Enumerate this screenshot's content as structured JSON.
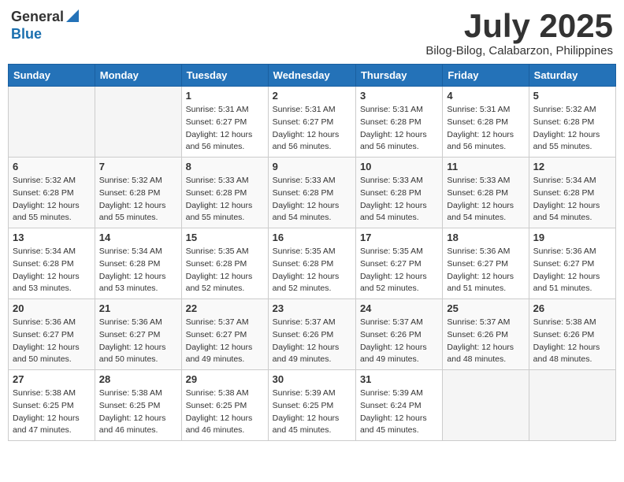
{
  "header": {
    "logo_general": "General",
    "logo_blue": "Blue",
    "month": "July 2025",
    "location": "Bilog-Bilog, Calabarzon, Philippines"
  },
  "weekdays": [
    "Sunday",
    "Monday",
    "Tuesday",
    "Wednesday",
    "Thursday",
    "Friday",
    "Saturday"
  ],
  "weeks": [
    [
      {
        "day": "",
        "info": ""
      },
      {
        "day": "",
        "info": ""
      },
      {
        "day": "1",
        "info": "Sunrise: 5:31 AM\nSunset: 6:27 PM\nDaylight: 12 hours and 56 minutes."
      },
      {
        "day": "2",
        "info": "Sunrise: 5:31 AM\nSunset: 6:27 PM\nDaylight: 12 hours and 56 minutes."
      },
      {
        "day": "3",
        "info": "Sunrise: 5:31 AM\nSunset: 6:28 PM\nDaylight: 12 hours and 56 minutes."
      },
      {
        "day": "4",
        "info": "Sunrise: 5:31 AM\nSunset: 6:28 PM\nDaylight: 12 hours and 56 minutes."
      },
      {
        "day": "5",
        "info": "Sunrise: 5:32 AM\nSunset: 6:28 PM\nDaylight: 12 hours and 55 minutes."
      }
    ],
    [
      {
        "day": "6",
        "info": "Sunrise: 5:32 AM\nSunset: 6:28 PM\nDaylight: 12 hours and 55 minutes."
      },
      {
        "day": "7",
        "info": "Sunrise: 5:32 AM\nSunset: 6:28 PM\nDaylight: 12 hours and 55 minutes."
      },
      {
        "day": "8",
        "info": "Sunrise: 5:33 AM\nSunset: 6:28 PM\nDaylight: 12 hours and 55 minutes."
      },
      {
        "day": "9",
        "info": "Sunrise: 5:33 AM\nSunset: 6:28 PM\nDaylight: 12 hours and 54 minutes."
      },
      {
        "day": "10",
        "info": "Sunrise: 5:33 AM\nSunset: 6:28 PM\nDaylight: 12 hours and 54 minutes."
      },
      {
        "day": "11",
        "info": "Sunrise: 5:33 AM\nSunset: 6:28 PM\nDaylight: 12 hours and 54 minutes."
      },
      {
        "day": "12",
        "info": "Sunrise: 5:34 AM\nSunset: 6:28 PM\nDaylight: 12 hours and 54 minutes."
      }
    ],
    [
      {
        "day": "13",
        "info": "Sunrise: 5:34 AM\nSunset: 6:28 PM\nDaylight: 12 hours and 53 minutes."
      },
      {
        "day": "14",
        "info": "Sunrise: 5:34 AM\nSunset: 6:28 PM\nDaylight: 12 hours and 53 minutes."
      },
      {
        "day": "15",
        "info": "Sunrise: 5:35 AM\nSunset: 6:28 PM\nDaylight: 12 hours and 52 minutes."
      },
      {
        "day": "16",
        "info": "Sunrise: 5:35 AM\nSunset: 6:28 PM\nDaylight: 12 hours and 52 minutes."
      },
      {
        "day": "17",
        "info": "Sunrise: 5:35 AM\nSunset: 6:27 PM\nDaylight: 12 hours and 52 minutes."
      },
      {
        "day": "18",
        "info": "Sunrise: 5:36 AM\nSunset: 6:27 PM\nDaylight: 12 hours and 51 minutes."
      },
      {
        "day": "19",
        "info": "Sunrise: 5:36 AM\nSunset: 6:27 PM\nDaylight: 12 hours and 51 minutes."
      }
    ],
    [
      {
        "day": "20",
        "info": "Sunrise: 5:36 AM\nSunset: 6:27 PM\nDaylight: 12 hours and 50 minutes."
      },
      {
        "day": "21",
        "info": "Sunrise: 5:36 AM\nSunset: 6:27 PM\nDaylight: 12 hours and 50 minutes."
      },
      {
        "day": "22",
        "info": "Sunrise: 5:37 AM\nSunset: 6:27 PM\nDaylight: 12 hours and 49 minutes."
      },
      {
        "day": "23",
        "info": "Sunrise: 5:37 AM\nSunset: 6:26 PM\nDaylight: 12 hours and 49 minutes."
      },
      {
        "day": "24",
        "info": "Sunrise: 5:37 AM\nSunset: 6:26 PM\nDaylight: 12 hours and 49 minutes."
      },
      {
        "day": "25",
        "info": "Sunrise: 5:37 AM\nSunset: 6:26 PM\nDaylight: 12 hours and 48 minutes."
      },
      {
        "day": "26",
        "info": "Sunrise: 5:38 AM\nSunset: 6:26 PM\nDaylight: 12 hours and 48 minutes."
      }
    ],
    [
      {
        "day": "27",
        "info": "Sunrise: 5:38 AM\nSunset: 6:25 PM\nDaylight: 12 hours and 47 minutes."
      },
      {
        "day": "28",
        "info": "Sunrise: 5:38 AM\nSunset: 6:25 PM\nDaylight: 12 hours and 46 minutes."
      },
      {
        "day": "29",
        "info": "Sunrise: 5:38 AM\nSunset: 6:25 PM\nDaylight: 12 hours and 46 minutes."
      },
      {
        "day": "30",
        "info": "Sunrise: 5:39 AM\nSunset: 6:25 PM\nDaylight: 12 hours and 45 minutes."
      },
      {
        "day": "31",
        "info": "Sunrise: 5:39 AM\nSunset: 6:24 PM\nDaylight: 12 hours and 45 minutes."
      },
      {
        "day": "",
        "info": ""
      },
      {
        "day": "",
        "info": ""
      }
    ]
  ]
}
